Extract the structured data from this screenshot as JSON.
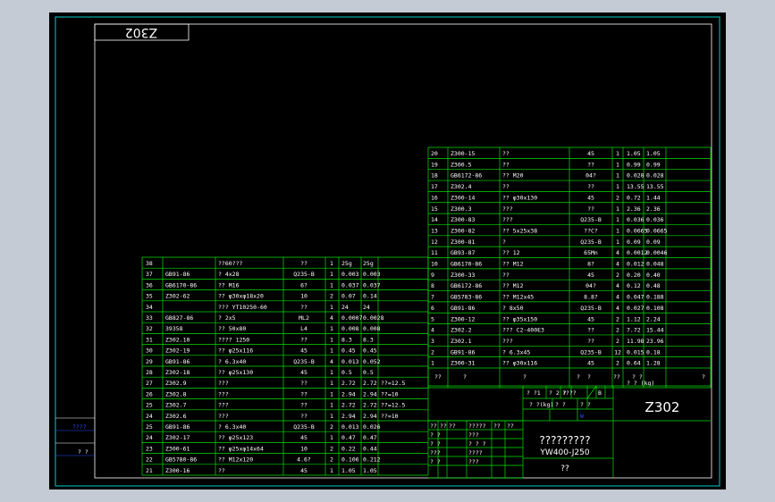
{
  "drawing_code": "Z302",
  "drawing_code_mirrored": "Z302",
  "title_name": "?????????",
  "model": "YW400-J250",
  "unit_cell": "??",
  "left_strip": {
    "top_label": "????",
    "bottom_label": "? ?"
  },
  "upper_parts": [
    [
      "20",
      "Z300-15",
      "??",
      "",
      "45",
      "1",
      "1.05",
      "1.05"
    ],
    [
      "19",
      "Z300.5",
      "??",
      "",
      "??",
      "1",
      "0.99",
      "0.99"
    ],
    [
      "18",
      "GB6172-86",
      "?? M20",
      "",
      "04?",
      "1",
      "0.028",
      "0.028"
    ],
    [
      "17",
      "Z302.4",
      "??",
      "",
      "??",
      "1",
      "13.55",
      "13.55"
    ],
    [
      "16",
      "Z300-14",
      "?? φ30x130",
      "",
      "45",
      "2",
      "0.72",
      "1.44"
    ],
    [
      "15",
      "Z300.3",
      "???",
      "",
      "??",
      "1",
      "2.36",
      "2.36"
    ],
    [
      "14",
      "Z300-83",
      "???",
      "",
      "Q235-B",
      "1",
      "0.036",
      "0.036"
    ],
    [
      "13",
      "Z300-82",
      "?? 5x25x38",
      "",
      "??C?",
      "1",
      "0.0665",
      "0.0665"
    ],
    [
      "12",
      "Z300-81",
      "?",
      "",
      "Q235-B",
      "1",
      "0.09",
      "0.09"
    ],
    [
      "11",
      "GB93-87",
      "?? 12",
      "",
      "65Mn",
      "4",
      "0.0012",
      "0.0046"
    ],
    [
      "10",
      "GB6170-86",
      "?? M12",
      "",
      "8?",
      "4",
      "0.012",
      "0.048"
    ],
    [
      "9",
      "Z300-33",
      "??",
      "",
      "45",
      "2",
      "0.20",
      "0.40"
    ],
    [
      "8",
      "GB6172-86",
      "?? M12",
      "",
      "04?",
      "4",
      "0.12",
      "0.48"
    ],
    [
      "7",
      "GB5783-86",
      "?? M12x45",
      "",
      "8.8?",
      "4",
      "0.047",
      "0.188"
    ],
    [
      "6",
      "GB91-86",
      "? 8x50",
      "",
      "Q235-B",
      "4",
      "0.027",
      "0.108"
    ],
    [
      "5",
      "Z300-12",
      "?? φ35x150",
      "",
      "45",
      "2",
      "1.12",
      "2.24"
    ],
    [
      "4",
      "Z302.2",
      "??? C2-400E3",
      "",
      "??",
      "2",
      "7.72",
      "15.44"
    ],
    [
      "3",
      "Z302.1",
      "???",
      "",
      "??",
      "2",
      "11.98",
      "23.96"
    ],
    [
      "2",
      "GB91-86",
      "? 6.3x45",
      "",
      "Q235-B",
      "12",
      "0.015",
      "0.18"
    ],
    [
      "1",
      "Z300-31",
      "?? φ30x116",
      "",
      "45",
      "2",
      "0.64",
      "1.28"
    ]
  ],
  "upper_header": [
    "??",
    "?",
    "?",
    "?",
    "?",
    "??",
    "? ?",
    "?"
  ],
  "upper_header_sub": "? ? (kg)",
  "lower_parts": [
    [
      "38",
      "",
      "??60???",
      "??",
      "1",
      "25g",
      "25g"
    ],
    [
      "37",
      "GB91-86",
      "? 4x28",
      "Q235-B",
      "1",
      "0.003",
      "0.003"
    ],
    [
      "36",
      "GB6170-86",
      "?? M16",
      "6?",
      "1",
      "0.037",
      "0.037"
    ],
    [
      "35",
      "Z302-62",
      "?? φ30xφ18x20",
      "10",
      "2",
      "0.07",
      "0.14"
    ],
    [
      "34",
      "",
      "??? YT10250-60",
      "??",
      "1",
      "24",
      "24"
    ],
    [
      "33",
      "GB827-86",
      "? 2x5",
      "ML2",
      "4",
      "0.0007",
      "0.0028"
    ],
    [
      "32",
      "39358",
      "?? 50x80",
      "L4",
      "1",
      "0.008",
      "0.008"
    ],
    [
      "31",
      "Z302.10",
      "???? 1250",
      "??",
      "1",
      "8.3",
      "8.3"
    ],
    [
      "30",
      "Z302-19",
      "?? φ25x116",
      "45",
      "1",
      "0.45",
      "0.45"
    ],
    [
      "29",
      "GB91-86",
      "? 6.3x40",
      "Q235-B",
      "4",
      "0.013",
      "0.052"
    ],
    [
      "28",
      "Z302-18",
      "?? φ25x130",
      "45",
      "1",
      "0.5",
      "0.5"
    ],
    [
      "27",
      "Z302.9",
      "???",
      "??",
      "1",
      "2.72",
      "2.72",
      "??=12.5"
    ],
    [
      "26",
      "Z302.8",
      "???",
      "??",
      "1",
      "2.94",
      "2.94",
      "??=10"
    ],
    [
      "25",
      "Z302.7",
      "???",
      "??",
      "1",
      "2.72",
      "2.72",
      "??=12.5"
    ],
    [
      "24",
      "Z302.6",
      "???",
      "??",
      "1",
      "2.94",
      "2.94",
      "??=10"
    ],
    [
      "25",
      "GB91-86",
      "? 6.3x40",
      "Q235-B",
      "2",
      "0.013",
      "0.026"
    ],
    [
      "24",
      "Z302-17",
      "?? φ25x123",
      "45",
      "1",
      "0.47",
      "0.47"
    ],
    [
      "23",
      "Z300-61",
      "?? φ25xφ14x64",
      "10",
      "2",
      "0.22",
      "0.44"
    ],
    [
      "22",
      "GB5780-86",
      "?? M12x120",
      "4.6?",
      "2",
      "0.106",
      "0.212"
    ],
    [
      "21",
      "Z300-16",
      "??",
      "45",
      "1",
      "1.05",
      "1.05"
    ]
  ],
  "title_block": {
    "row1": [
      "? ?1",
      "? 2 ?",
      "????",
      "",
      "B"
    ],
    "row2": [
      "? ?(kg)",
      "? ?",
      "? ?"
    ],
    "marks": [
      "",
      "W",
      ""
    ],
    "sign_rows": [
      [
        "??",
        "??",
        "??",
        "?????",
        "??",
        "??"
      ],
      [
        "? ?",
        "",
        "",
        "???",
        "",
        ""
      ],
      [
        "? ?",
        "",
        "",
        "? ? ?",
        "",
        ""
      ],
      [
        "???",
        "",
        "",
        "????",
        "",
        ""
      ],
      [
        "? ?",
        "",
        "",
        "???",
        "",
        ""
      ]
    ]
  },
  "colors": {
    "line": "#00e000",
    "frame": "#00cccc",
    "text": "#ffffff",
    "background": "#000000",
    "accent_blue": "#2a4dff"
  }
}
